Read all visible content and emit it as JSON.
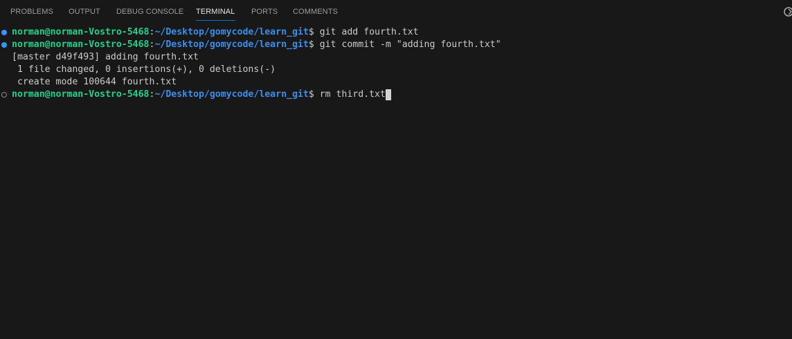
{
  "tabs": [
    {
      "label": "PROBLEMS",
      "active": false
    },
    {
      "label": "OUTPUT",
      "active": false
    },
    {
      "label": "DEBUG CONSOLE",
      "active": false
    },
    {
      "label": "TERMINAL",
      "active": true
    },
    {
      "label": "PORTS",
      "active": false
    },
    {
      "label": "COMMENTS",
      "active": false
    }
  ],
  "colors": {
    "background": "#181818",
    "accent": "#0078d4",
    "prompt_user": "#23d18b",
    "prompt_path": "#3b8eea",
    "text": "#cccccc",
    "tab_inactive": "#9d9d9d",
    "tab_active": "#e7e7e7",
    "decoration_success": "#3794ff"
  },
  "terminal": {
    "prompt_user": "norman@norman-Vostro-5468",
    "prompt_sep": ":",
    "prompt_path": "~/Desktop/gomycode/learn_git",
    "prompt_suffix": "$ ",
    "commands": [
      "git add fourth.txt",
      "git commit -m \"adding fourth.txt\"",
      "rm third.txt"
    ],
    "output": [
      "[master d49f493] adding fourth.txt",
      " 1 file changed, 0 insertions(+), 0 deletions(-)",
      " create mode 100644 fourth.txt"
    ]
  },
  "icons": {
    "top_right": "edge-icon",
    "command_marker_done": "circle-filled-icon",
    "command_marker_current": "circle-outline-icon"
  }
}
